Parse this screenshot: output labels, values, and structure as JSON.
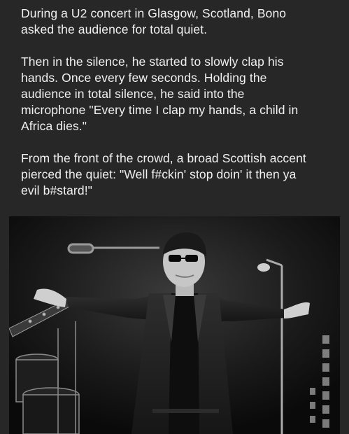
{
  "post": {
    "paragraphs": [
      "During a U2 concert in Glasgow, Scotland, Bono\nasked the audience for total quiet.",
      "Then in the silence, he started to slowly clap his\nhands. Once every few seconds. Holding the\naudience in total silence, he said into the\nmicrophone \"Every time I clap my hands, a child in\nAfrica dies.\"",
      "From the front of the crowd, a broad Scottish accent\npierced the quiet: \"Well f#ckin' stop doin' it then ya\nevil b#stard!\""
    ]
  },
  "colors": {
    "background": "#272727",
    "text": "#f1f1f1"
  }
}
